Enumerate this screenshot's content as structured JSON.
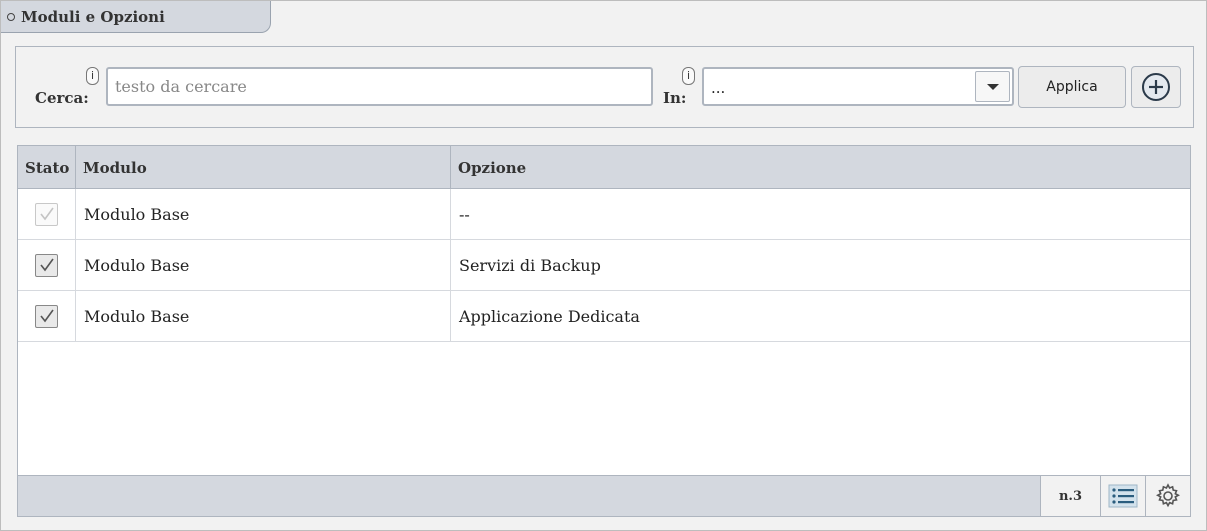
{
  "section": {
    "title": "Moduli e Opzioni",
    "icon": "circle-icon"
  },
  "search": {
    "label": "Cerca:",
    "info": "i",
    "placeholder": "testo da cercare",
    "value": ""
  },
  "in_filter": {
    "label": "In:",
    "info": "i",
    "value": "..."
  },
  "buttons": {
    "apply": "Applica",
    "add_icon": "plus-circle-icon"
  },
  "table": {
    "headers": {
      "stato": "Stato",
      "modulo": "Modulo",
      "opzione": "Opzione"
    },
    "rows": [
      {
        "checked": true,
        "disabled": true,
        "modulo": "Modulo Base",
        "opzione": "--"
      },
      {
        "checked": true,
        "disabled": false,
        "modulo": "Modulo Base",
        "opzione": "Servizi di Backup"
      },
      {
        "checked": true,
        "disabled": false,
        "modulo": "Modulo Base",
        "opzione": "Applicazione Dedicata"
      }
    ]
  },
  "footer": {
    "count": "n.3",
    "list_icon": "list-icon",
    "settings_icon": "gear-icon"
  },
  "colors": {
    "header_bg": "#d4d8df",
    "border": "#aeb5bf",
    "accent_icon": "#2b5d7e"
  }
}
